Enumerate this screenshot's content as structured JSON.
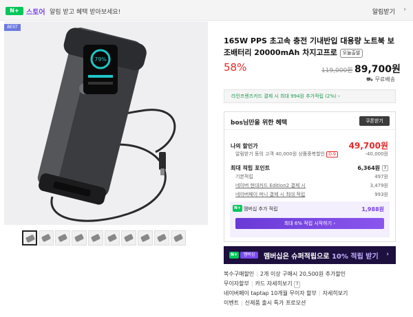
{
  "topbar": {
    "store_badge": "N+",
    "store_label": "스토어",
    "message": "알림 받고 혜택 받아보세요!",
    "alarm_label": "알림받기",
    "chevron": "›"
  },
  "gallery": {
    "best_badge": "BEST",
    "thumbnail_count": 10,
    "device_screen_text": "79%"
  },
  "product": {
    "title": "165W PPS 초고속 충전 기내반입 대용량 노트북 보조배터리 20000mAh 차지고프로",
    "today_badge": "오늘출발",
    "discount": "58%",
    "original_price": "119,000원",
    "price": "89,700원",
    "shipping": "무료배송"
  },
  "card_promo": {
    "text": "라인프렌즈카드 결제 시 최대 994원 추가적립 (2%)",
    "chevron": "›"
  },
  "benefits": {
    "header": "bos님만을 위한 혜택",
    "coupon_button": "쿠폰받기",
    "final_price_label": "나의 할인가",
    "final_price_value": "49,700원",
    "coupon_desc": "알림받기 동의 고객 40,000원 상품중복할인",
    "coupon_tag": "D-9",
    "coupon_amount": "-40,000원",
    "points_label": "최대 적립 포인트",
    "points_value": "6,364원",
    "rows": [
      {
        "label": "기본적립",
        "value": "497원"
      },
      {
        "label": "네이버 현대카드 Edition2 결제 시",
        "value": "3,479원"
      },
      {
        "label": "네이버페이 머니 결제 시 최대 적립",
        "value": "993원"
      }
    ],
    "membership_label": "멤버십 추가 적립",
    "membership_value": "1,988원",
    "membership_button": "최대 6% 적립 시작하기",
    "membership_chevron": "›"
  },
  "banner": {
    "badge": "N+",
    "membership_badge": "멤버십",
    "text_before": "멤버십은 슈퍼적립으로 ",
    "text_highlight": "10% 적립 받기",
    "arrow": "›"
  },
  "info_rows": [
    {
      "label": "복수구매할인",
      "value": "2개 이상 구매시 20,500원 추가할인"
    },
    {
      "label": "무이자할부",
      "value": "카드 자세히보기"
    },
    {
      "label": "네이버페이 taptap 10개월 무이자 할부",
      "value": "자세히보기"
    },
    {
      "label": "이벤트",
      "value": "신제품 출시 특가 프로모션"
    }
  ]
}
